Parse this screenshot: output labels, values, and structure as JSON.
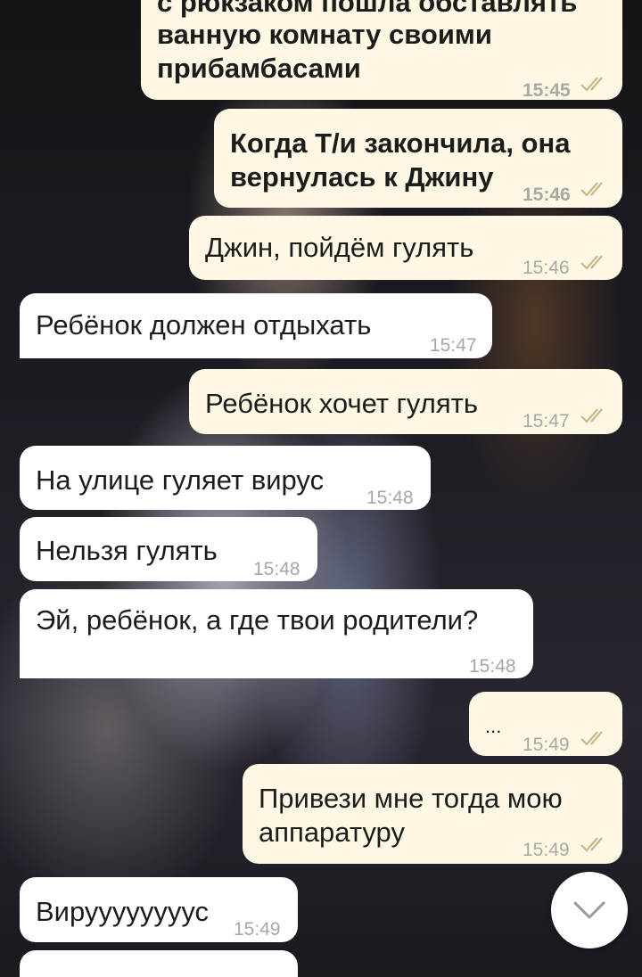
{
  "messages": [
    {
      "dir": "out",
      "text_partial_top": "с рюкзаком пошла обставлять",
      "text": "ванную комнату своими прибамбасами",
      "time": "15:45",
      "status": "read"
    },
    {
      "dir": "out",
      "text": "Когда Т/и закончила, она вернулась к Джину",
      "time": "15:46",
      "status": "read"
    },
    {
      "dir": "out",
      "text": "Джин, пойдём гулять",
      "time": "15:46",
      "status": "read"
    },
    {
      "dir": "in",
      "text": "Ребёнок должен отдыхать",
      "time": "15:47"
    },
    {
      "dir": "out",
      "text": "Ребёнок хочет гулять",
      "time": "15:47",
      "status": "read"
    },
    {
      "dir": "in",
      "text": "На улице гуляет вирус",
      "time": "15:48"
    },
    {
      "dir": "in",
      "text": "Нельзя гулять",
      "time": "15:48"
    },
    {
      "dir": "in",
      "text": "Эй, ребёнок, а где твои родители?",
      "time": "15:48"
    },
    {
      "dir": "out",
      "text": "...",
      "time": "15:49",
      "status": "read"
    },
    {
      "dir": "out",
      "text": "Привези мне тогда мою аппаратуру",
      "time": "15:49",
      "status": "read"
    },
    {
      "dir": "in",
      "text": "Вируууууууус",
      "time": "15:49"
    }
  ],
  "icons": {
    "read_status": "double-check-icon",
    "scroll_down": "chevron-down-icon"
  },
  "colors": {
    "outgoing_bubble": "#fdf7e4",
    "incoming_bubble": "#ffffff",
    "tick": "#c9b98a",
    "time": "#a9a9a3"
  }
}
